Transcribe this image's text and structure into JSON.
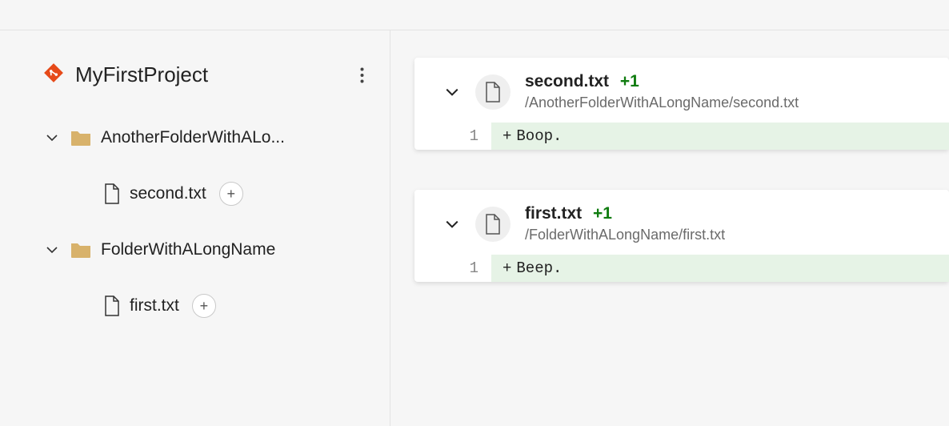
{
  "project": {
    "icon": "git-diamond-icon",
    "title": "MyFirstProject"
  },
  "tree": {
    "folders": [
      {
        "label": "AnotherFolderWithALo...",
        "expanded": true,
        "files": [
          {
            "label": "second.txt",
            "has_add": true
          }
        ]
      },
      {
        "label": "FolderWithALongName",
        "expanded": true,
        "files": [
          {
            "label": "first.txt",
            "has_add": true
          }
        ]
      }
    ]
  },
  "diffs": [
    {
      "filename": "second.txt",
      "delta": "+1",
      "path": "/AnotherFolderWithALongName/second.txt",
      "line_number": "1",
      "line_prefix": "+",
      "line_text": "Boop."
    },
    {
      "filename": "first.txt",
      "delta": "+1",
      "path": "/FolderWithALongName/first.txt",
      "line_number": "1",
      "line_prefix": "+",
      "line_text": "Beep."
    }
  ],
  "glyphs": {
    "add_plus": "+"
  }
}
